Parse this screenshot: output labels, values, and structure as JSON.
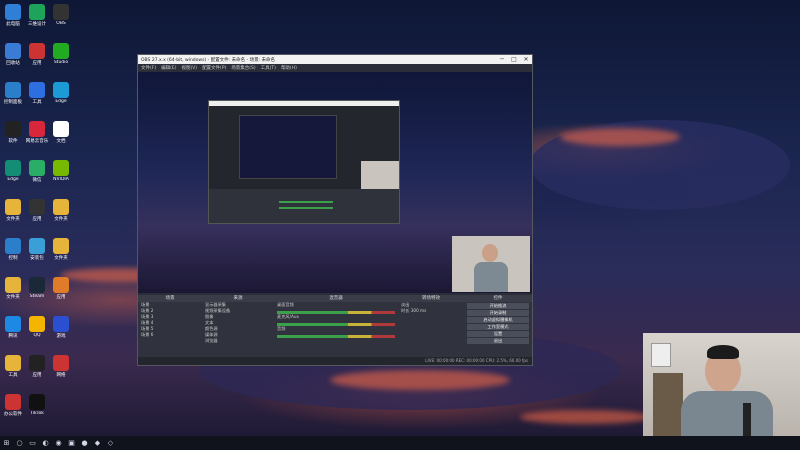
{
  "colors": {
    "accent": "#3aa14a",
    "meter_warn": "#c8b33a",
    "meter_peak": "#b03a3a",
    "obs_bg": "#2b2e38"
  },
  "desktop_icons": [
    {
      "label": "此电脑",
      "icon": "computer-icon",
      "color": "#2f7fd6"
    },
    {
      "label": "三维设计",
      "icon": "triangle-app-icon",
      "color": "#1ea35b"
    },
    {
      "label": "OBS",
      "icon": "obs-icon",
      "color": "#333"
    },
    {
      "label": "回收站",
      "icon": "recycle-bin-icon",
      "color": "#3a7bd5"
    },
    {
      "label": "应用",
      "icon": "app-icon",
      "color": "#c33"
    },
    {
      "label": "Studio",
      "icon": "studio-icon",
      "color": "#2a2"
    },
    {
      "label": "控制面板",
      "icon": "control-panel-icon",
      "color": "#2b7ec9"
    },
    {
      "label": "工具",
      "icon": "tool-icon",
      "color": "#2d6fe0"
    },
    {
      "label": "Edge",
      "icon": "edge-icon",
      "color": "#1b9ad6"
    },
    {
      "label": "软件",
      "icon": "software-icon",
      "color": "#222"
    },
    {
      "label": "网易云音乐",
      "icon": "music-icon",
      "color": "#d8263a"
    },
    {
      "label": "文档",
      "icon": "document-icon",
      "color": "#fff"
    },
    {
      "label": "Edge",
      "icon": "edge-icon",
      "color": "#138d75"
    },
    {
      "label": "微信",
      "icon": "wechat-icon",
      "color": "#2aae67"
    },
    {
      "label": "NVIDIA",
      "icon": "nvidia-icon",
      "color": "#76b900"
    },
    {
      "label": "文件夹",
      "icon": "folder-icon",
      "color": "#e7b43b"
    },
    {
      "label": "应用",
      "icon": "app-icon",
      "color": "#333"
    },
    {
      "label": "文件夹",
      "icon": "folder-icon",
      "color": "#e7b43b"
    },
    {
      "label": "控制",
      "icon": "control-icon",
      "color": "#2b7ec9"
    },
    {
      "label": "安装包",
      "icon": "installer-icon",
      "color": "#3a9fd6"
    },
    {
      "label": "文件夹",
      "icon": "folder-icon",
      "color": "#e7b43b"
    },
    {
      "label": "文件夹",
      "icon": "folder-icon",
      "color": "#e7b43b"
    },
    {
      "label": "Steam",
      "icon": "steam-icon",
      "color": "#1b2838"
    },
    {
      "label": "应用",
      "icon": "app-icon",
      "color": "#e07b2a"
    },
    {
      "label": "腾讯",
      "icon": "tencent-icon",
      "color": "#1e88e5"
    },
    {
      "label": "QQ",
      "icon": "qq-icon",
      "color": "#f4b400"
    },
    {
      "label": "游戏",
      "icon": "game-icon",
      "color": "#2a4fd0"
    },
    {
      "label": "工具",
      "icon": "tool-icon",
      "color": "#e7b43b"
    },
    {
      "label": "应用",
      "icon": "app-icon",
      "color": "#222"
    },
    {
      "label": "网络",
      "icon": "network-icon",
      "color": "#c33"
    },
    {
      "label": "办公软件",
      "icon": "office-icon",
      "color": "#c33"
    },
    {
      "label": "TikTok",
      "icon": "tiktok-icon",
      "color": "#111"
    }
  ],
  "obs": {
    "title": "OBS 27.x.x (64-bit, windows) - 配置文件: 未命名 - 场景: 未命名",
    "menu": [
      "文件(F)",
      "编辑(E)",
      "视图(V)",
      "配置文件(P)",
      "场景集合(S)",
      "工具(T)",
      "帮助(H)"
    ],
    "scenes_header": "场景",
    "sources_header": "来源",
    "mixer_header": "混音器",
    "transition_header": "转场特效",
    "controls_header": "控件",
    "scenes": [
      "场景",
      "场景 2",
      "场景 3",
      "场景 4",
      "场景 5",
      "场景 6"
    ],
    "sources": [
      "显示器采集",
      "视频采集设备",
      "图像",
      "文本",
      "颜色源",
      "媒体源",
      "浏览器"
    ],
    "mixer_tracks": [
      "桌面音频",
      "麦克风/Aux",
      "音频"
    ],
    "transition": {
      "label": "淡出",
      "duration_label": "时长",
      "duration": "300 ms"
    },
    "controls": [
      "开始推流",
      "开始录制",
      "启动虚拟摄像机",
      "工作室模式",
      "设置",
      "退出"
    ],
    "status": "LIVE: 00:00:00  REC: 00:00:00  CPU: 2.5%, 60.00 fps"
  }
}
